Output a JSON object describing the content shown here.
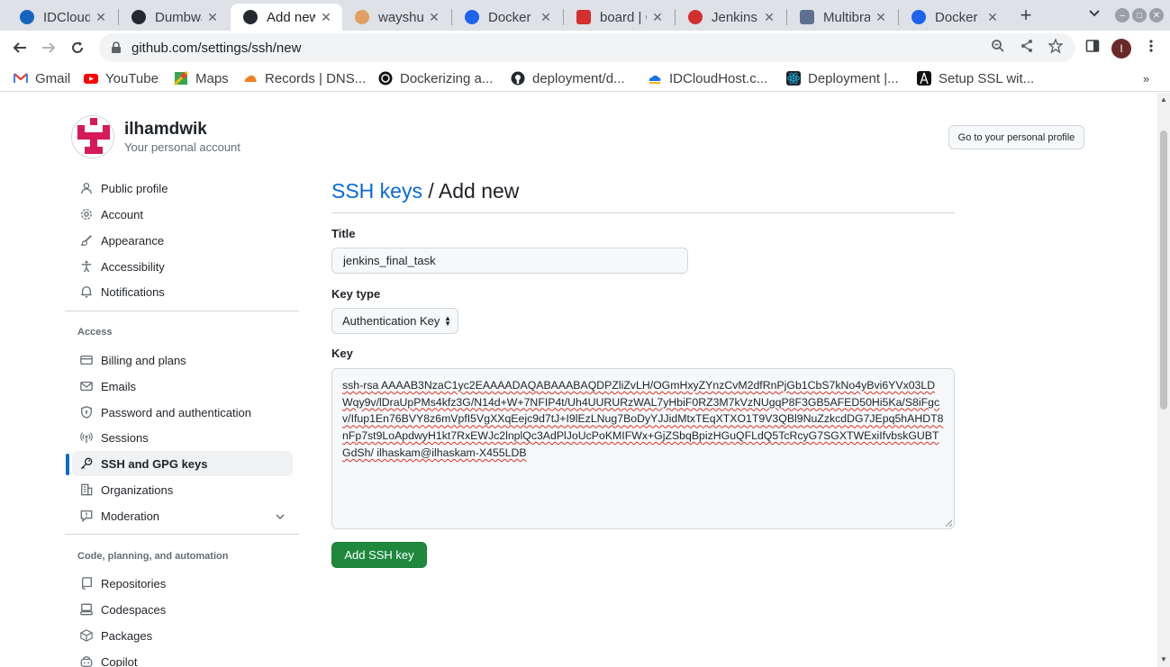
{
  "browser": {
    "tabs": [
      {
        "title": "IDCloudHost",
        "icon": "idcloudhost-icon",
        "color": "#1565c0"
      },
      {
        "title": "Dumbways",
        "icon": "github-icon",
        "color": "#24292f"
      },
      {
        "title": "Add new",
        "icon": "github-icon",
        "color": "#24292f"
      },
      {
        "title": "wayshub",
        "icon": "wayshub-icon",
        "color": "#e0a060"
      },
      {
        "title": "Docker Hub",
        "icon": "docker-icon",
        "color": "#1d63ed"
      },
      {
        "title": "board | C",
        "icon": "board-icon",
        "color": "#d32f2f"
      },
      {
        "title": "Jenkins",
        "icon": "jenkins-icon",
        "color": "#d32f2f"
      },
      {
        "title": "Multibranch",
        "icon": "multibranch-icon",
        "color": "#5f6f8f"
      },
      {
        "title": "Docker Hub",
        "icon": "docker-icon",
        "color": "#1d63ed"
      }
    ],
    "url": "github.com/settings/ssh/new",
    "profile_initial": "I",
    "bookmarks": [
      {
        "label": "Gmail",
        "icon": "gmail-icon",
        "color": "#ea4335"
      },
      {
        "label": "YouTube",
        "icon": "youtube-icon",
        "color": "#ff0000"
      },
      {
        "label": "Maps",
        "icon": "maps-icon",
        "color": "#34a853"
      },
      {
        "label": "Records | DNS...",
        "icon": "cloudflare-icon",
        "color": "#f38020"
      },
      {
        "label": "Dockerizing a...",
        "icon": "circle-icon",
        "color": "#111111"
      },
      {
        "label": "deployment/d...",
        "icon": "github-icon",
        "color": "#24292f"
      },
      {
        "label": "IDCloudHost.c...",
        "icon": "idcloudhost-icon",
        "color": "#1a73e8"
      },
      {
        "label": "Deployment |...",
        "icon": "react-icon",
        "color": "#149eca"
      },
      {
        "label": "Setup SSL wit...",
        "icon": "setup-icon",
        "color": "#111111"
      }
    ]
  },
  "account": {
    "name": "ilhamdwik",
    "subtitle": "Your personal account",
    "profile_button": "Go to your personal profile"
  },
  "sidebar": {
    "items_top": [
      {
        "label": "Public profile",
        "icon": "person-icon"
      },
      {
        "label": "Account",
        "icon": "gear-icon"
      },
      {
        "label": "Appearance",
        "icon": "paintbrush-icon"
      },
      {
        "label": "Accessibility",
        "icon": "accessibility-icon"
      },
      {
        "label": "Notifications",
        "icon": "bell-icon"
      }
    ],
    "access_heading": "Access",
    "items_access": [
      {
        "label": "Billing and plans",
        "icon": "credit-card-icon"
      },
      {
        "label": "Emails",
        "icon": "mail-icon"
      },
      {
        "label": "Password and authentication",
        "icon": "shield-lock-icon"
      },
      {
        "label": "Sessions",
        "icon": "broadcast-icon"
      },
      {
        "label": "SSH and GPG keys",
        "icon": "key-icon",
        "selected": true
      },
      {
        "label": "Organizations",
        "icon": "organization-icon"
      },
      {
        "label": "Moderation",
        "icon": "report-icon"
      }
    ],
    "code_heading": "Code, planning, and automation",
    "items_code": [
      {
        "label": "Repositories",
        "icon": "repo-icon"
      },
      {
        "label": "Codespaces",
        "icon": "codespaces-icon"
      },
      {
        "label": "Packages",
        "icon": "package-icon"
      },
      {
        "label": "Copilot",
        "icon": "copilot-icon"
      }
    ]
  },
  "main": {
    "breadcrumb_link": "SSH keys",
    "breadcrumb_rest": " / Add new",
    "title_label": "Title",
    "title_value": "jenkins_final_task",
    "keytype_label": "Key type",
    "keytype_value": "Authentication Key",
    "key_label": "Key",
    "key_value": "ssh-rsa AAAAB3NzaC1yc2EAAAADAQABAAABAQDPZliZvLH/OGmHxyZYnzCvM2dfRnPjGb1CbS7kNo4yBvi6YVx03LDWqy9v/lDraUpPMs4kfz3G/N14d+W+7NFIP4t/Uh4UURURzWAL7yHbiF0RZ3M7kVzNUgqP8F3GB5AFED50Hi5Ka/S8iFgcv/Ifup1En76BVY8z6mVpfI5VgXXqEejc9d7tJ+I9lEzLNug7BoDyYJJidMtxTEqXTXO1T9V3QBl9NuZzkcdDG7JEpq5hAHDT8nFp7st9LoApdwyH1kt7RxEWJc2lnplQc3AdPlJoUcPoKMIFWx+GjZSbqBpizHGuQFLdQ5TcRcyG7SGXTWExiIfvbskGUBTGdSh/ ilhaskam@ilhaskam-X455LDB",
    "submit_label": "Add SSH key"
  }
}
